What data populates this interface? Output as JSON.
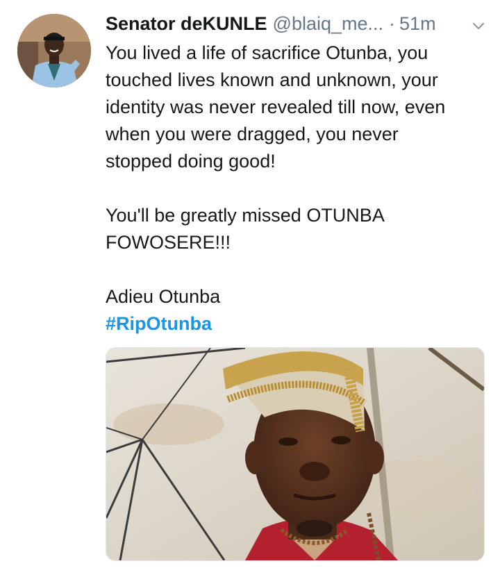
{
  "tweet": {
    "author": {
      "display_name": "Senator deKUNLE",
      "handle": "@blaiq_me...",
      "avatar_icon": "user-avatar-photo"
    },
    "separator": "·",
    "time": "51m",
    "menu_icon": "chevron-down-icon",
    "text": {
      "p1_lines": [
        "You lived a life of sacrifice Otunba, you",
        "touched lives known and unknown, your",
        "identity was never revealed till now, even",
        "when you were dragged, you never",
        "stopped doing good!"
      ],
      "p2_lines": [
        "You'll be greatly missed OTUNBA",
        "FOWOSERE!!!"
      ],
      "p3_line": "Adieu Otunba",
      "hashtag": "#RipOtunba"
    },
    "media": {
      "kind": "photo"
    }
  },
  "colors": {
    "text": "#14171a",
    "secondary": "#657786",
    "link": "#1b95e0"
  }
}
